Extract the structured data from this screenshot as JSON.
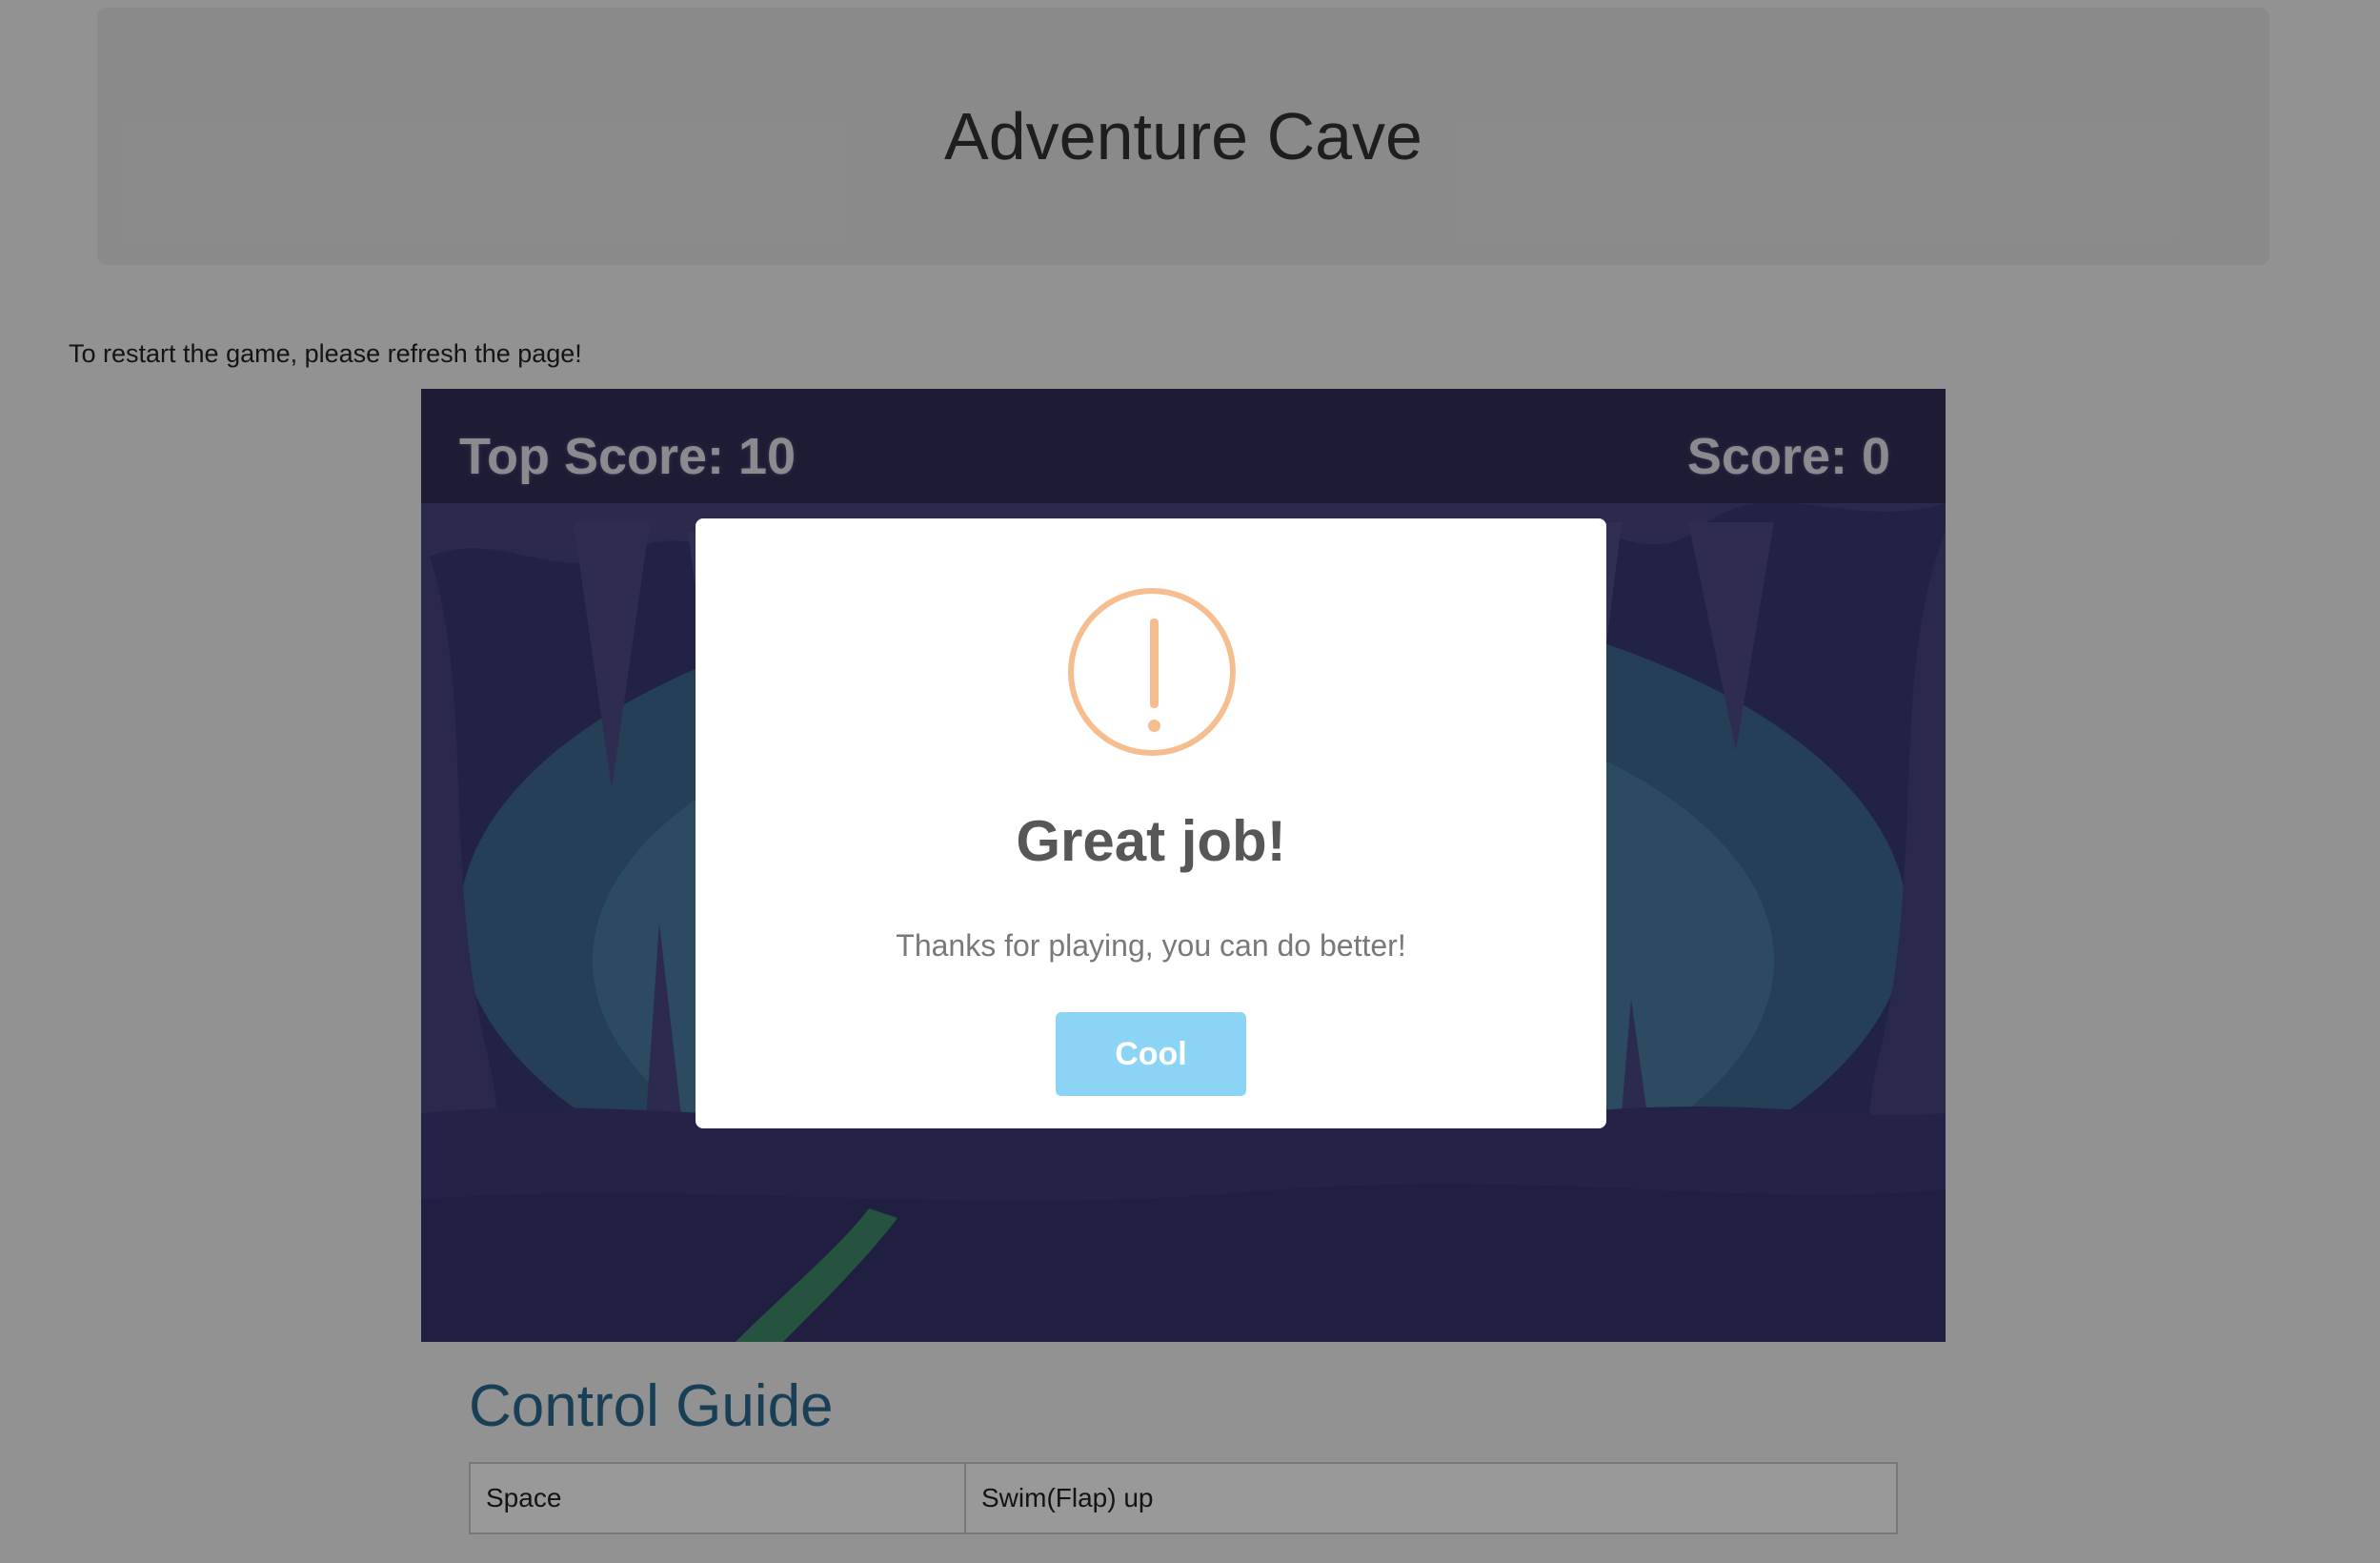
{
  "header": {
    "title": "Adventure Cave"
  },
  "notice": "To restart the game, please refresh the page!",
  "game": {
    "top_score_label": "Top Score: 10",
    "score_label": "Score: 0"
  },
  "control_guide": {
    "title": "Control Guide",
    "rows": [
      {
        "key": "Space",
        "action": "Swim(Flap) up"
      }
    ]
  },
  "modal": {
    "icon": "warning-icon",
    "title": "Great job!",
    "text": "Thanks for playing, you can do better!",
    "button_label": "Cool"
  },
  "colors": {
    "accent_warning": "#f8bb86",
    "button": "#8cd4f5",
    "guide_title": "#2a6a8f"
  }
}
